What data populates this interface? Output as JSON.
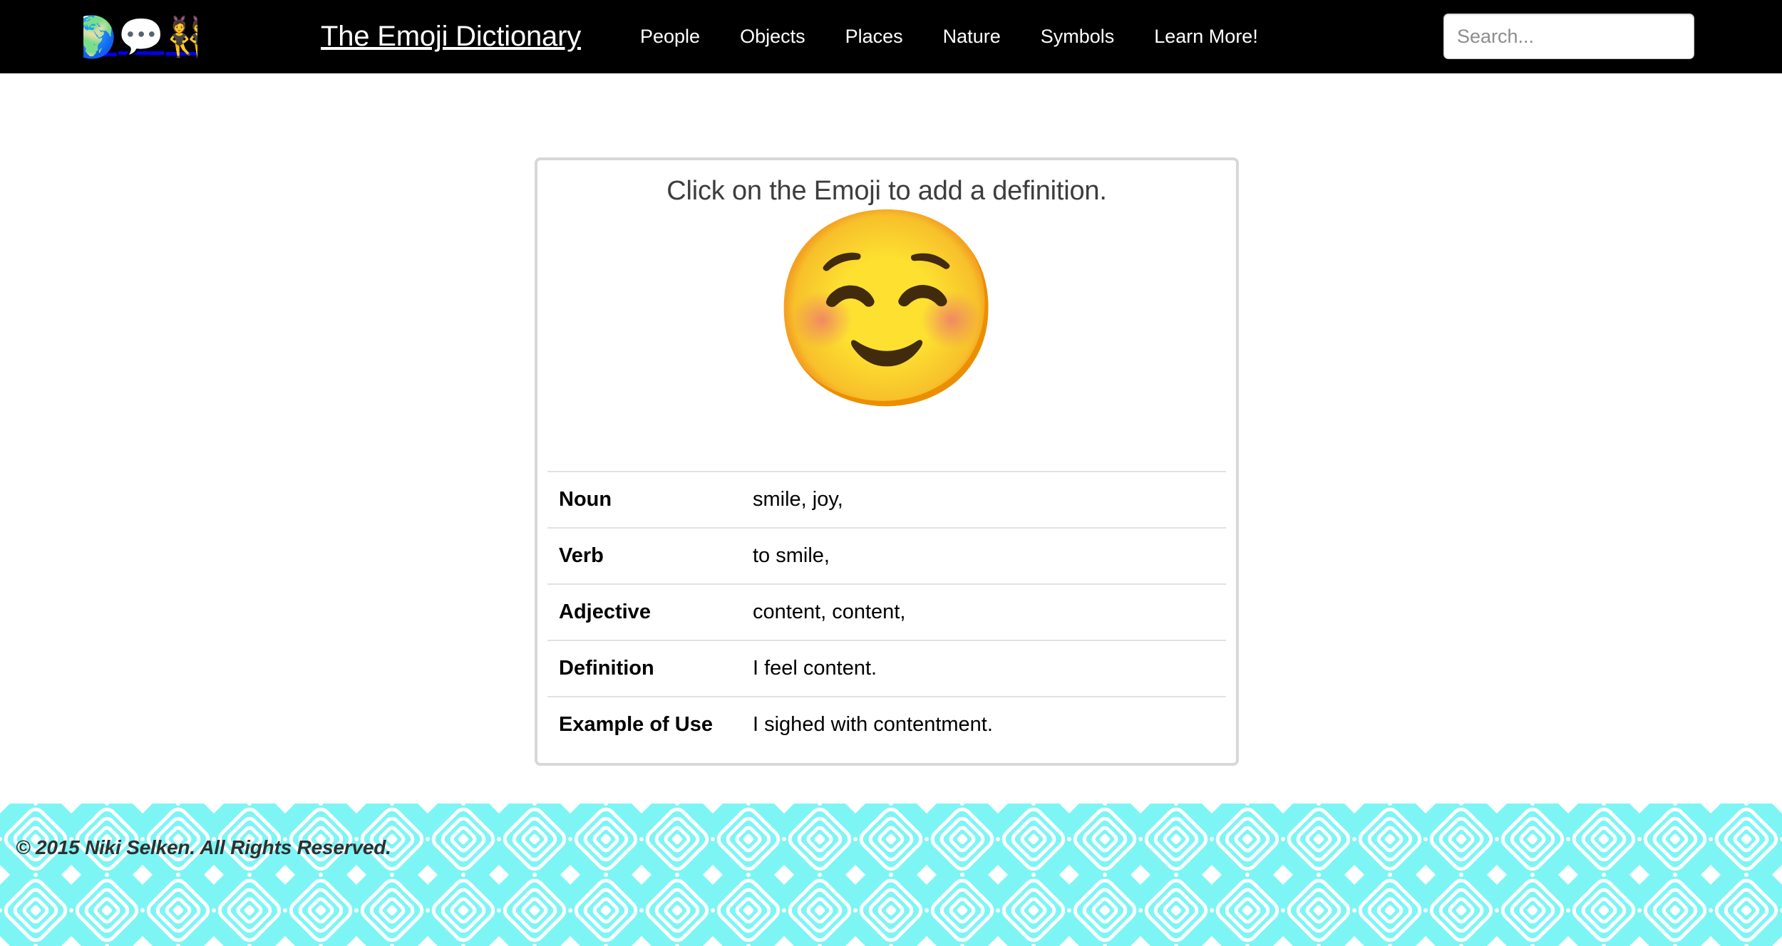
{
  "header": {
    "logo": {
      "globe_icon": "🌍",
      "speech_icon": "💬",
      "dancers_icon": "👯"
    },
    "title": "The Emoji Dictionary",
    "nav_items": [
      {
        "label": "People"
      },
      {
        "label": "Objects"
      },
      {
        "label": "Places"
      },
      {
        "label": "Nature"
      },
      {
        "label": "Symbols"
      },
      {
        "label": "Learn More!"
      }
    ],
    "search": {
      "placeholder": "Search...",
      "value": ""
    },
    "background_color": "#000000",
    "text_color": "#ffffff"
  },
  "main": {
    "card": {
      "heading": "Click on the Emoji to add a definition.",
      "emoji": "☺️",
      "emoji_name": "white-smiling-face",
      "border_color": "#d8d8d8",
      "definitions": [
        {
          "label": "Noun",
          "value": "smile, joy,"
        },
        {
          "label": "Verb",
          "value": "to smile,"
        },
        {
          "label": "Adjective",
          "value": "content, content,"
        },
        {
          "label": "Definition",
          "value": "I feel content."
        },
        {
          "label": "Example of Use",
          "value": "I sighed with contentment."
        }
      ]
    }
  },
  "footer": {
    "copyright": "© 2015 Niki Selken. All Rights Reserved.",
    "background_color": "#7ef5f5",
    "pattern_color": "#ffffff"
  }
}
